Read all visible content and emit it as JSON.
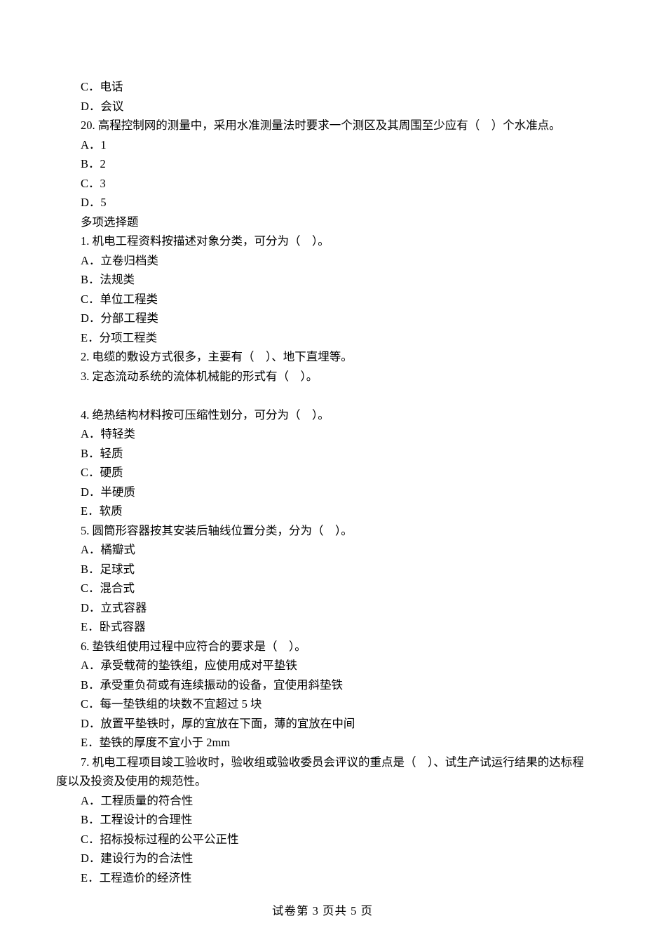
{
  "options_pre": [
    "C．电话",
    "D．会议"
  ],
  "q20": "20. 高程控制网的测量中，采用水准测量法时要求一个测区及其周围至少应有（　）个水准点。",
  "q20_options": [
    "A．1",
    "B．2",
    "C．3",
    "D．5"
  ],
  "multi_heading": "多项选择题",
  "m1": "1. 机电工程资料按描述对象分类，可分为（　）。",
  "m1_options": [
    "A．立卷归档类",
    "B．法规类",
    "C．单位工程类",
    "D．分部工程类",
    "E．分项工程类"
  ],
  "m2": "2. 电缆的敷设方式很多，主要有（　）、地下直埋等。",
  "m3": "3. 定态流动系统的流体机械能的形式有（　）。",
  "m4": "4. 绝热结构材料按可压缩性划分，可分为（　）。",
  "m4_options": [
    "A．特轻类",
    "B．轻质",
    "C．硬质",
    "D．半硬质",
    "E．软质"
  ],
  "m5": "5. 圆筒形容器按其安装后轴线位置分类，分为（　）。",
  "m5_options": [
    "A．橘瓣式",
    "B．足球式",
    "C．混合式",
    "D．立式容器",
    "E．卧式容器"
  ],
  "m6": "6. 垫铁组使用过程中应符合的要求是（　）。",
  "m6_options": [
    "A．承受载荷的垫铁组，应使用成对平垫铁",
    "B．承受重负荷或有连续振动的设备，宜使用斜垫铁",
    "C．每一垫铁组的块数不宜超过 5 块",
    "D．放置平垫铁时，厚的宜放在下面，薄的宜放在中间",
    "E．垫铁的厚度不宜小于 2mm"
  ],
  "m7": "7. 机电工程项目竣工验收时，验收组或验收委员会评议的重点是（　）、试生产试运行结果的达标程度以及投资及使用的规范性。",
  "m7_options": [
    "A．工程质量的符合性",
    "B．工程设计的合理性",
    "C．招标投标过程的公平公正性",
    "D．建设行为的合法性",
    "E．工程造价的经济性"
  ],
  "footer": "试卷第 3 页共 5 页"
}
